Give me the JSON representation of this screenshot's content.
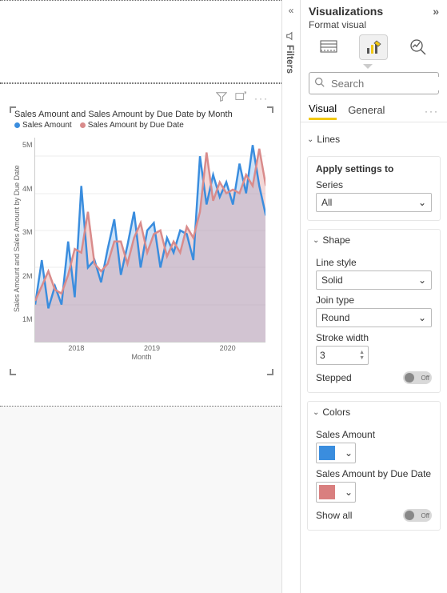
{
  "collapse": {
    "filters_label": "Filters"
  },
  "panel": {
    "title": "Visualizations",
    "subtitle": "Format visual",
    "search_placeholder": "Search",
    "tabs": {
      "visual": "Visual",
      "general": "General"
    },
    "lines_section": "Lines",
    "apply_header": "Apply settings to",
    "series_label": "Series",
    "series_value": "All",
    "shape_section": "Shape",
    "line_style_label": "Line style",
    "line_style_value": "Solid",
    "join_type_label": "Join type",
    "join_type_value": "Round",
    "stroke_width_label": "Stroke width",
    "stroke_width_value": "3",
    "stepped_label": "Stepped",
    "stepped_value": "Off",
    "colors_section": "Colors",
    "color1_label": "Sales Amount",
    "color1_hex": "#3a8dde",
    "color2_label": "Sales Amount by Due Date",
    "color2_hex": "#d97f7f",
    "showall_label": "Show all",
    "showall_value": "Off"
  },
  "chart": {
    "title": "Sales Amount and Sales Amount by Due Date by Month",
    "legend": {
      "s1": "Sales Amount",
      "s2": "Sales Amount by Due Date"
    },
    "ylabels": [
      "5M",
      "4M",
      "3M",
      "2M",
      "1M"
    ],
    "xlabels": [
      "2018",
      "2019",
      "2020"
    ],
    "xaxis_title": "Month",
    "yaxis_title": "Sales Amount and Sales Amount by Due Date"
  },
  "chart_data": {
    "type": "line",
    "xlabel": "Month",
    "ylabel": "Sales Amount and Sales Amount by Due Date",
    "ylim": [
      0,
      5500000
    ],
    "title": "Sales Amount and Sales Amount by Due Date by Month",
    "x": [
      "2017-07",
      "2017-08",
      "2017-09",
      "2017-10",
      "2017-11",
      "2017-12",
      "2018-01",
      "2018-02",
      "2018-03",
      "2018-04",
      "2018-05",
      "2018-06",
      "2018-07",
      "2018-08",
      "2018-09",
      "2018-10",
      "2018-11",
      "2018-12",
      "2019-01",
      "2019-02",
      "2019-03",
      "2019-04",
      "2019-05",
      "2019-06",
      "2019-07",
      "2019-08",
      "2019-09",
      "2019-10",
      "2019-11",
      "2019-12",
      "2020-01",
      "2020-02",
      "2020-03",
      "2020-04",
      "2020-05",
      "2020-06"
    ],
    "series": [
      {
        "name": "Sales Amount",
        "color": "#3a8dde",
        "values": [
          1000000,
          2200000,
          900000,
          1500000,
          1000000,
          2700000,
          1200000,
          4200000,
          2000000,
          2200000,
          1600000,
          2500000,
          3300000,
          1800000,
          2600000,
          3500000,
          2000000,
          3000000,
          3200000,
          2000000,
          2800000,
          2400000,
          3000000,
          2900000,
          2200000,
          5000000,
          3700000,
          4500000,
          3900000,
          4300000,
          3700000,
          4800000,
          4000000,
          5300000,
          4200000,
          3400000
        ]
      },
      {
        "name": "Sales Amount by Due Date",
        "color": "#d97f7f",
        "values": [
          1100000,
          1500000,
          1900000,
          1400000,
          1300000,
          1800000,
          2500000,
          2400000,
          3500000,
          2100000,
          1900000,
          2100000,
          2700000,
          2700000,
          2100000,
          2800000,
          3200000,
          2400000,
          2900000,
          3000000,
          2300000,
          2700000,
          2400000,
          3100000,
          2800000,
          3500000,
          5100000,
          3800000,
          4300000,
          4000000,
          4100000,
          4000000,
          4500000,
          4200000,
          5200000,
          4200000
        ]
      }
    ]
  }
}
